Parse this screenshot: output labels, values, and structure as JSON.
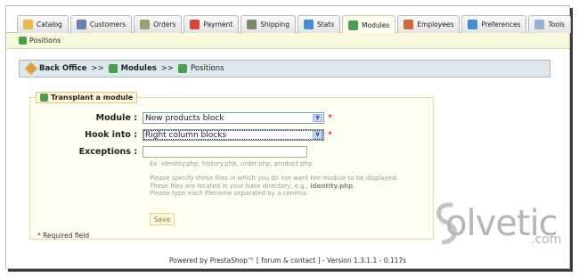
{
  "tabs": [
    {
      "label": "Catalog",
      "icon": "folder-icon",
      "color": "#e8b84a"
    },
    {
      "label": "Customers",
      "icon": "customers-icon",
      "color": "#6a7fb0"
    },
    {
      "label": "Orders",
      "icon": "orders-icon",
      "color": "#9aa070"
    },
    {
      "label": "Payment",
      "icon": "payment-icon",
      "color": "#d04a3a"
    },
    {
      "label": "Shipping",
      "icon": "shipping-icon",
      "color": "#7a8a6a"
    },
    {
      "label": "Stats",
      "icon": "stats-icon",
      "color": "#4a8ad0"
    },
    {
      "label": "Modules",
      "icon": "modules-icon",
      "color": "#4aa04a"
    },
    {
      "label": "Employees",
      "icon": "employees-icon",
      "color": "#d06a3a"
    },
    {
      "label": "Preferences",
      "icon": "preferences-icon",
      "color": "#4a8ad0"
    },
    {
      "label": "Tools",
      "icon": "tools-icon",
      "color": "#9ab0d0"
    }
  ],
  "active_tab": "Modules",
  "subnav": {
    "label": "Positions"
  },
  "breadcrumb": {
    "items": [
      "Back Office",
      "Modules",
      "Positions"
    ],
    "separator": ">>"
  },
  "form": {
    "legend": "Transplant a module",
    "module_label": "Module :",
    "module_value": "New products block",
    "hook_label": "Hook into :",
    "hook_value": "Right column blocks",
    "exceptions_label": "Exceptions :",
    "exceptions_value": "",
    "exceptions_example": "Ex: identity.php, history.php, order.php, product.php",
    "help_line1": "Please specify those files in which you do not want the module to be displayed.",
    "help_line2_pre": "These files are located in your base directory, e.g.,",
    "help_line2_bold": "identity.php",
    "help_line2_post": ".",
    "help_line3": "Please type each filename separated by a comma.",
    "save_label": "Save",
    "required_star": "*",
    "required_note": "Required field"
  },
  "footer": {
    "text": "Powered by PrestaShop™ [ forum & contact ] - Version 1.3.1.1 - 0.117s"
  },
  "watermark": {
    "text": "olvetic",
    "suffix": ".com"
  },
  "colors": {
    "accent_required": "#dd0000",
    "breadcrumb_bg": "#dde7ec",
    "fieldset_bg": "#fffff2"
  }
}
